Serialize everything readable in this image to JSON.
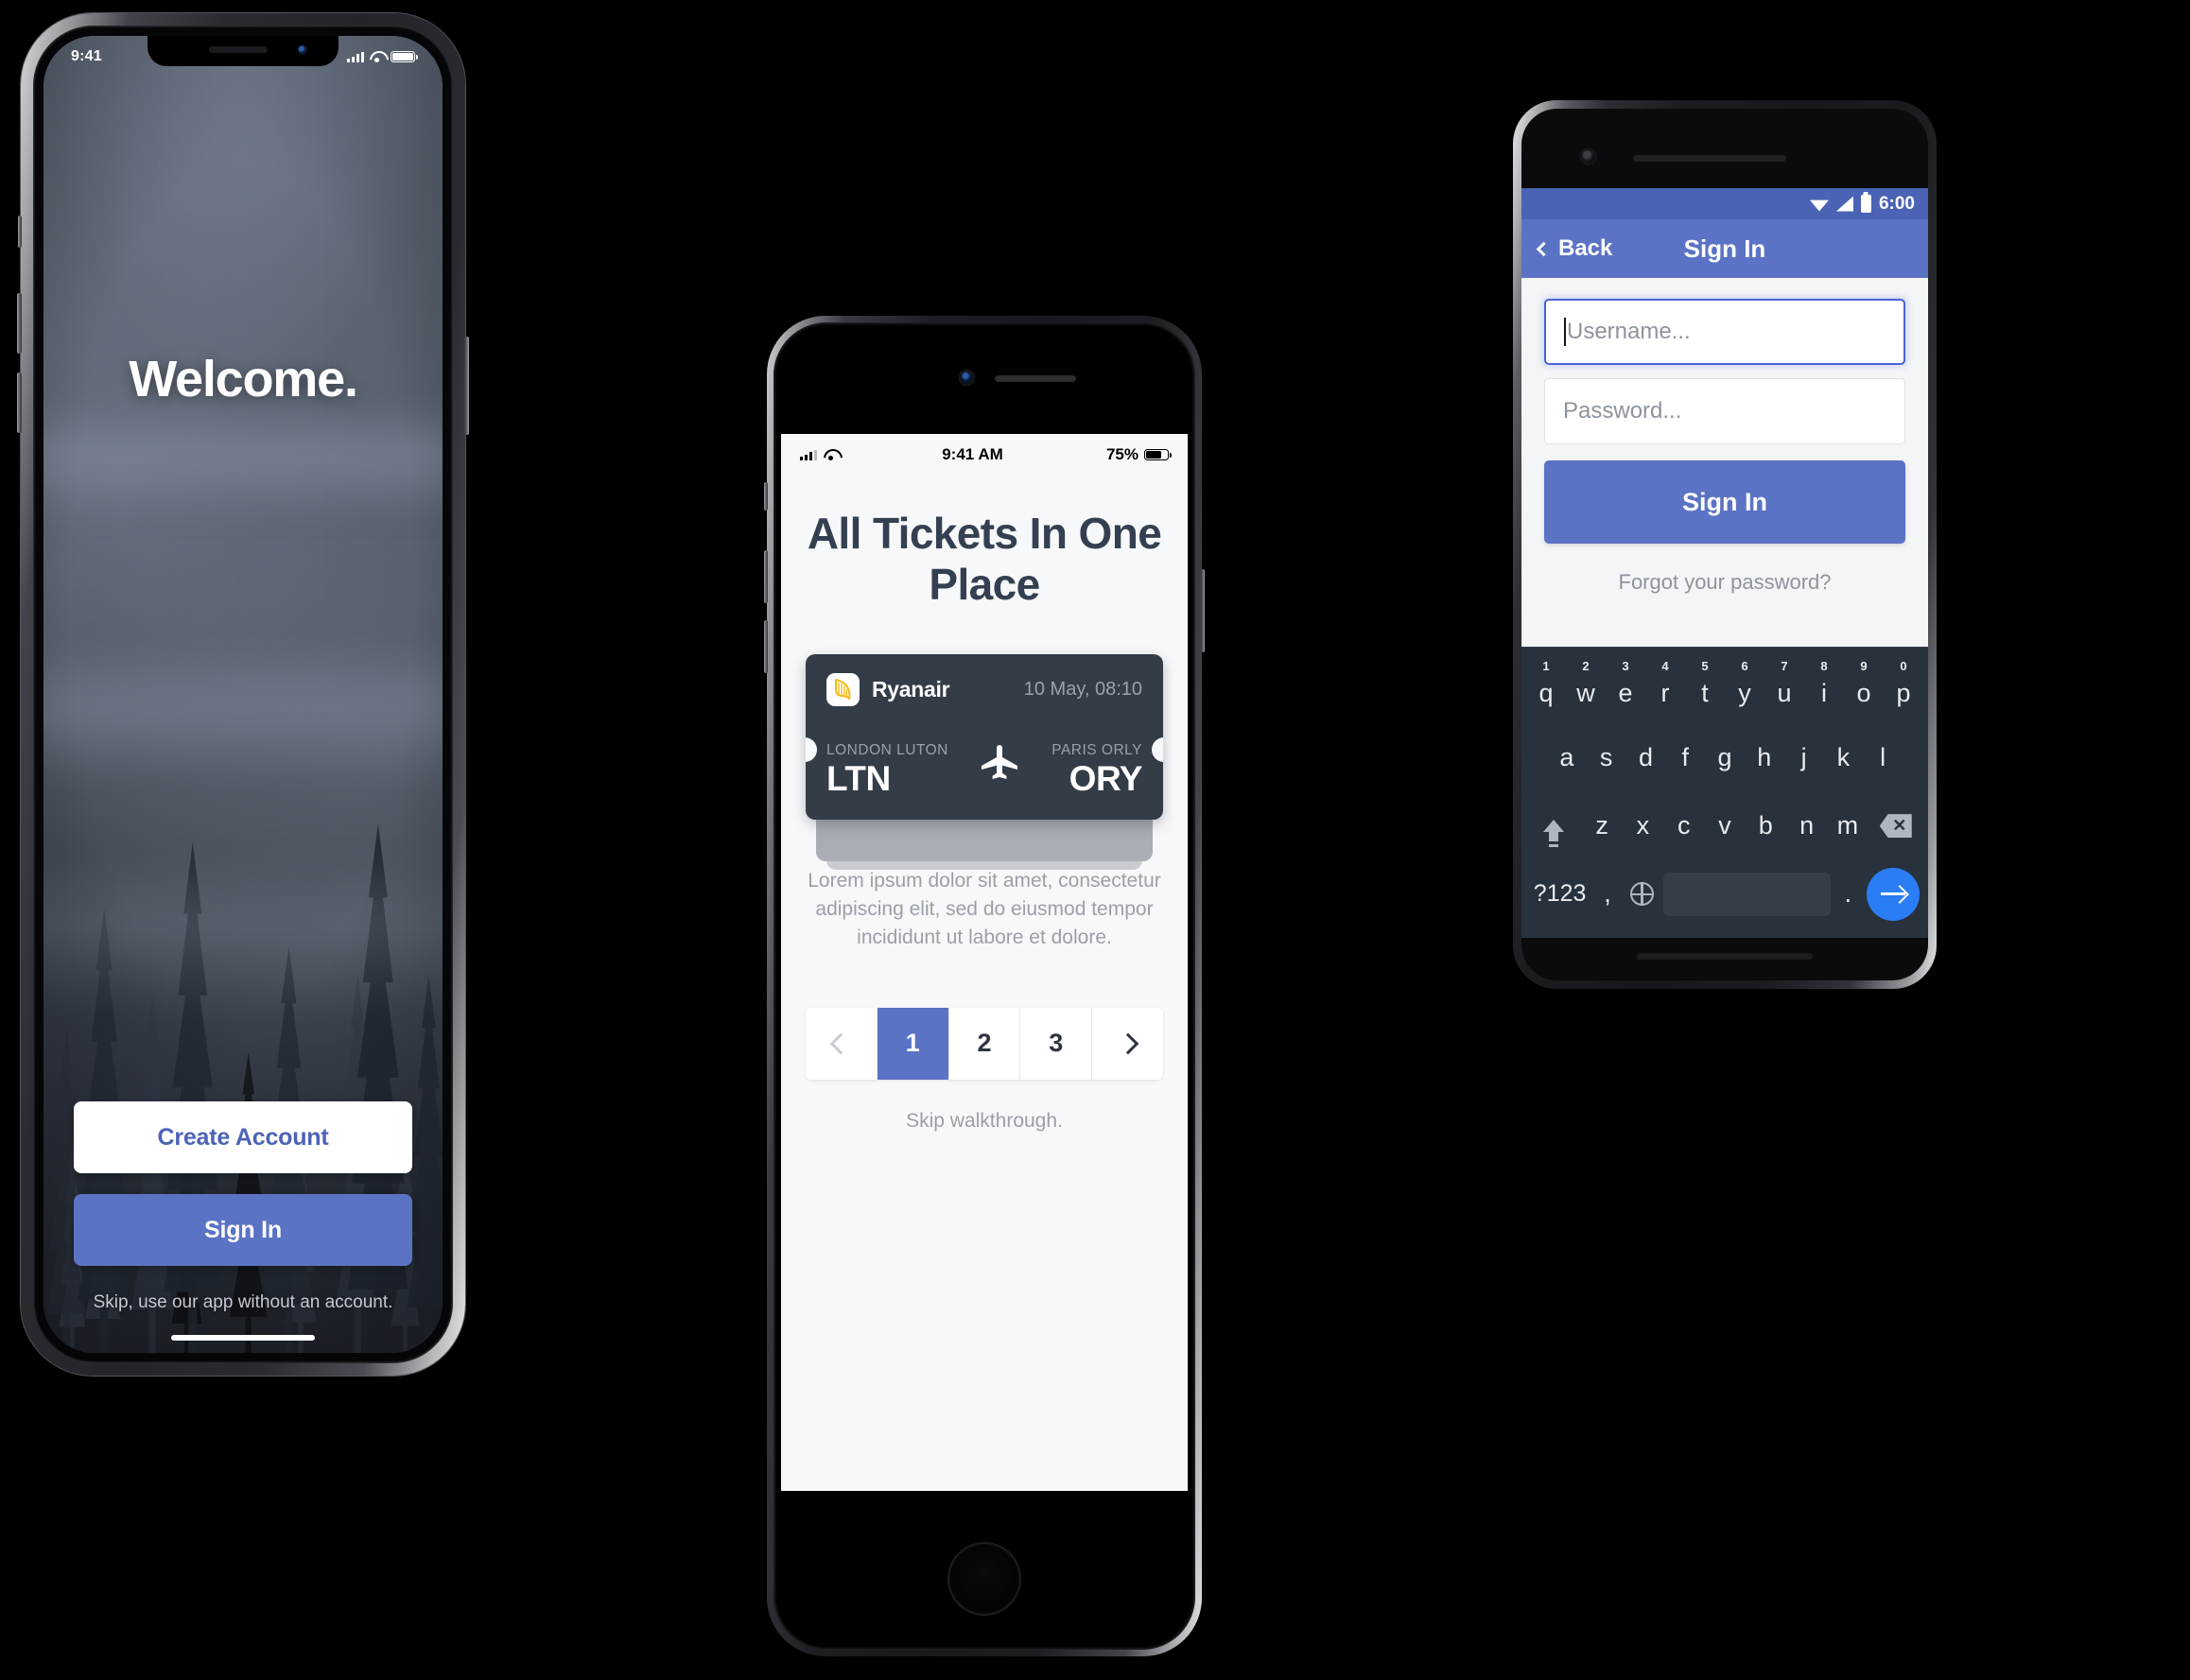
{
  "welcome_phone": {
    "status_bar": {
      "time": "9:41",
      "signal_icon": "cellular-bars-icon",
      "wifi_icon": "wifi-icon",
      "battery_icon": "battery-icon"
    },
    "title": "Welcome.",
    "create_account_label": "Create Account",
    "sign_in_label": "Sign In",
    "skip_note": "Skip, use our app without an account."
  },
  "walkthrough_phone": {
    "status_bar": {
      "time": "9:41 AM",
      "battery_percent": "75%",
      "signal_icon": "cellular-bars-icon",
      "wifi_icon": "wifi-icon",
      "battery_icon": "battery-icon"
    },
    "title": "All Tickets In One Place",
    "ticket": {
      "airline": "Ryanair",
      "airline_logo_icon": "ryanair-harp-icon",
      "date": "10 May, 08:10",
      "origin_city": "LONDON LUTON",
      "origin_code": "LTN",
      "destination_city": "PARIS ORLY",
      "destination_code": "ORY",
      "plane_icon": "airplane-icon"
    },
    "body_text": "Lorem ipsum dolor sit amet, consectetur adipiscing elit, sed do eiusmod tempor incididunt ut labore et dolore.",
    "pagination": {
      "prev_icon": "chevron-left-icon",
      "next_icon": "chevron-right-icon",
      "pages": [
        "1",
        "2",
        "3"
      ],
      "active_page": "1"
    },
    "skip_label": "Skip walkthrough."
  },
  "signin_phone": {
    "status_bar": {
      "time": "6:00",
      "wifi_icon": "wifi-icon",
      "signal_icon": "signal-triangle-icon",
      "battery_icon": "battery-icon"
    },
    "app_bar": {
      "back_label": "Back",
      "back_icon": "chevron-left-icon",
      "title": "Sign In"
    },
    "username_placeholder": "Username...",
    "password_placeholder": "Password...",
    "sign_in_label": "Sign In",
    "forgot_label": "Forgot your password?",
    "keyboard": {
      "row1": [
        {
          "letter": "q",
          "num": "1"
        },
        {
          "letter": "w",
          "num": "2"
        },
        {
          "letter": "e",
          "num": "3"
        },
        {
          "letter": "r",
          "num": "4"
        },
        {
          "letter": "t",
          "num": "5"
        },
        {
          "letter": "y",
          "num": "6"
        },
        {
          "letter": "u",
          "num": "7"
        },
        {
          "letter": "i",
          "num": "8"
        },
        {
          "letter": "o",
          "num": "9"
        },
        {
          "letter": "p",
          "num": "0"
        }
      ],
      "row2": [
        "a",
        "s",
        "d",
        "f",
        "g",
        "h",
        "j",
        "k",
        "l"
      ],
      "row3": [
        "z",
        "x",
        "c",
        "v",
        "b",
        "n",
        "m"
      ],
      "shift_icon": "shift-icon",
      "delete_icon": "backspace-icon",
      "symbols_label": "?123",
      "comma_label": ",",
      "globe_icon": "globe-icon",
      "period_label": ".",
      "enter_icon": "enter-arrow-icon"
    }
  },
  "colors": {
    "accent_blue": "#5b73c4",
    "ticket_dark": "#343c47",
    "android_statusbar": "#4a63b5",
    "keyboard_bg": "#28323c",
    "enter_blue": "#2a7df4",
    "ryanair_yellow": "#f5b812"
  }
}
